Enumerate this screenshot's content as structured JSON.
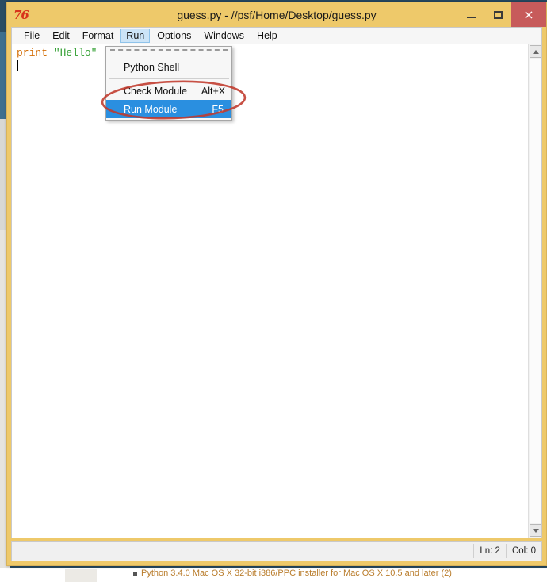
{
  "window": {
    "title": "guess.py - //psf/Home/Desktop/guess.py",
    "app_icon": "python-idle-icon",
    "icon_glyph": "76",
    "controls": {
      "minimize": "minimize-icon",
      "maximize": "maximize-icon",
      "close_label": "×"
    },
    "frame_color": "#eec96a"
  },
  "menubar": {
    "items": [
      {
        "label": "File",
        "active": false
      },
      {
        "label": "Edit",
        "active": false
      },
      {
        "label": "Format",
        "active": false
      },
      {
        "label": "Run",
        "active": true
      },
      {
        "label": "Options",
        "active": false
      },
      {
        "label": "Windows",
        "active": false
      },
      {
        "label": "Help",
        "active": false
      }
    ],
    "active_highlight_color": "#cce4f7"
  },
  "run_menu": {
    "tearoff": true,
    "items": [
      {
        "label": "Python Shell",
        "accel": "",
        "selected": false
      },
      {
        "label": "Check Module",
        "accel": "Alt+X",
        "selected": false
      },
      {
        "label": "Run Module",
        "accel": "F5",
        "selected": true
      }
    ],
    "selected_bg": "#2a8fe0",
    "selected_fg": "#ffffff"
  },
  "editor": {
    "line1": {
      "keyword": "print",
      "space": " ",
      "string": "\"Hello\""
    },
    "caret_line": 2,
    "keyword_color": "#d4700a",
    "string_color": "#2f9e2f"
  },
  "scrollbar": {
    "up_arrow": "scroll-up-arrow-icon",
    "down_arrow": "scroll-down-arrow-icon"
  },
  "statusbar": {
    "line": "Ln: 2",
    "col": "Col: 0"
  },
  "annotation": {
    "shape": "red-ellipse-highlight",
    "color": "#c0392b",
    "targets": "Run Module F5"
  },
  "background": {
    "partial_text": "Python 3.4.0 Mac OS X 32-bit i386/PPC installer for Mac OS X 10.5 and later (2)"
  }
}
